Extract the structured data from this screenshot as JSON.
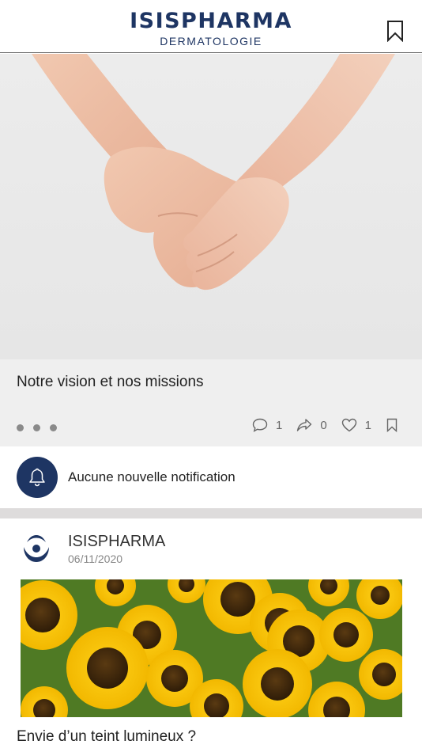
{
  "header": {
    "brand_name": "ISISPHARMA",
    "brand_sub": "DERMATOLOGIE",
    "bookmark_icon": "bookmark-icon"
  },
  "hero": {
    "image": "holding-hands-photo",
    "title": "Notre vision et nos missions",
    "carousel_dots": 3,
    "stats": {
      "comments": "1",
      "shares": "0",
      "likes": "1"
    }
  },
  "notification": {
    "icon": "bell-icon",
    "text": "Aucune nouvelle notification"
  },
  "post": {
    "author": "ISISPHARMA",
    "date": "06/11/2020",
    "image": "sunflowers-photo",
    "title": "Envie d’un teint lumineux ?"
  },
  "colors": {
    "brand": "#1e3563",
    "card_bg": "#efefef",
    "divider": "#dedcdc"
  }
}
